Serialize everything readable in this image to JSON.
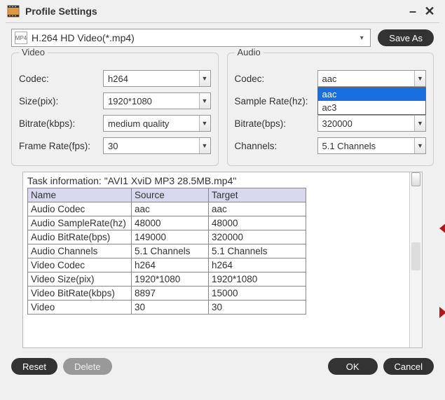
{
  "window": {
    "title": "Profile Settings"
  },
  "profile": {
    "selected": "H.264 HD Video(*.mp4)",
    "save_as_label": "Save As"
  },
  "video": {
    "legend": "Video",
    "codec_label": "Codec:",
    "codec_value": "h264",
    "size_label": "Size(pix):",
    "size_value": "1920*1080",
    "bitrate_label": "Bitrate(kbps):",
    "bitrate_value": "medium quality",
    "framerate_label": "Frame Rate(fps):",
    "framerate_value": "30"
  },
  "audio": {
    "legend": "Audio",
    "codec_label": "Codec:",
    "codec_value": "aac",
    "codec_options": [
      "aac",
      "ac3"
    ],
    "samplerate_label": "Sample Rate(hz):",
    "samplerate_value": "",
    "bitrate_label": "Bitrate(bps):",
    "bitrate_value": "320000",
    "channels_label": "Channels:",
    "channels_value": "5.1 Channels"
  },
  "task": {
    "header": "Task information: \"AVI1 XviD MP3 28.5MB.mp4\"",
    "columns": [
      "Name",
      "Source",
      "Target"
    ],
    "rows": [
      {
        "name": "Audio Codec",
        "source": "aac",
        "target": "aac"
      },
      {
        "name": "Audio SampleRate(hz)",
        "source": "48000",
        "target": "48000"
      },
      {
        "name": "Audio BitRate(bps)",
        "source": "149000",
        "target": "320000"
      },
      {
        "name": "Audio Channels",
        "source": "5.1 Channels",
        "target": "5.1 Channels"
      },
      {
        "name": "Video Codec",
        "source": "h264",
        "target": "h264"
      },
      {
        "name": "Video Size(pix)",
        "source": "1920*1080",
        "target": "1920*1080"
      },
      {
        "name": "Video BitRate(kbps)",
        "source": "8897",
        "target": "15000"
      },
      {
        "name": "Video",
        "source": "30",
        "target": "30"
      }
    ]
  },
  "footer": {
    "reset": "Reset",
    "delete": "Delete",
    "ok": "OK",
    "cancel": "Cancel"
  }
}
